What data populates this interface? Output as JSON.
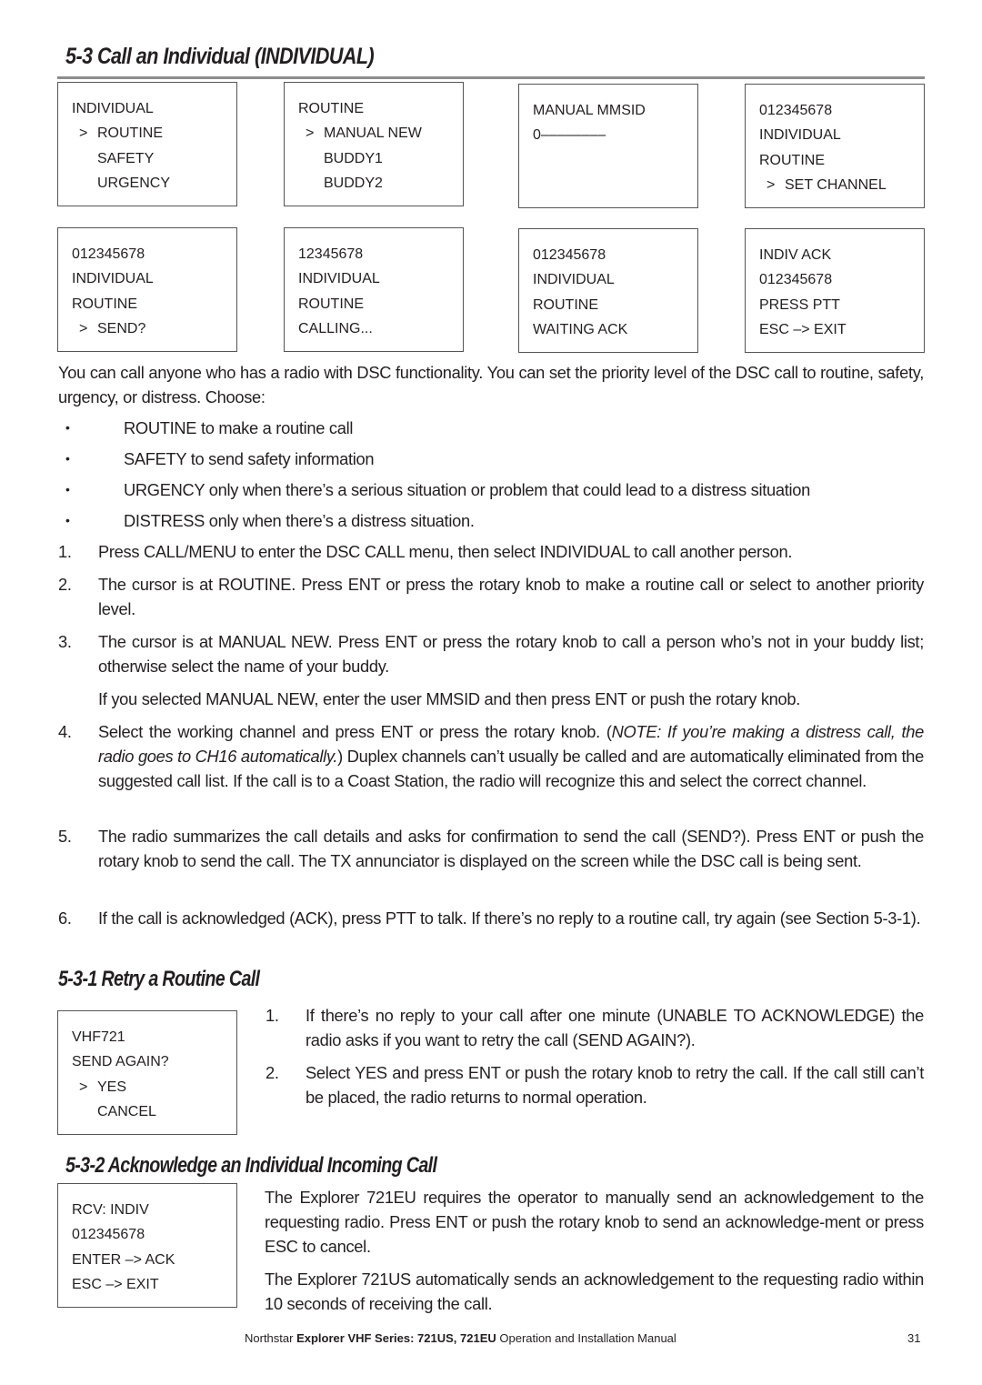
{
  "section": {
    "title": "5-3 Call an Individual (INDIVIDUAL)",
    "screens_row1": [
      {
        "lines": [
          {
            "text": "INDIVIDUAL",
            "style": "plain"
          },
          {
            "text": "ROUTINE",
            "style": "selected"
          },
          {
            "text": "SAFETY",
            "style": "indent"
          },
          {
            "text": "URGENCY",
            "style": "indent"
          }
        ]
      },
      {
        "lines": [
          {
            "text": "ROUTINE",
            "style": "plain"
          },
          {
            "text": "MANUAL NEW",
            "style": "selected"
          },
          {
            "text": "BUDDY1",
            "style": "indent"
          },
          {
            "text": "BUDDY2",
            "style": "indent"
          }
        ]
      },
      {
        "lines": [
          {
            "text": "MANUAL MMSID",
            "style": "plain"
          },
          {
            "text": "0––––––––",
            "style": "plain"
          }
        ]
      },
      {
        "lines": [
          {
            "text": "012345678",
            "style": "plain"
          },
          {
            "text": "INDIVIDUAL",
            "style": "plain"
          },
          {
            "text": "ROUTINE",
            "style": "plain"
          },
          {
            "text": "SET CHANNEL",
            "style": "selected"
          }
        ]
      }
    ],
    "screens_row2": [
      {
        "lines": [
          {
            "text": "012345678",
            "style": "plain"
          },
          {
            "text": "INDIVIDUAL",
            "style": "plain"
          },
          {
            "text": "ROUTINE",
            "style": "plain"
          },
          {
            "text": "SEND?",
            "style": "selected"
          }
        ]
      },
      {
        "lines": [
          {
            "text": "12345678",
            "style": "plain"
          },
          {
            "text": "INDIVIDUAL",
            "style": "plain"
          },
          {
            "text": "ROUTINE",
            "style": "plain"
          },
          {
            "text": "CALLING...",
            "style": "plain"
          }
        ]
      },
      {
        "lines": [
          {
            "text": "012345678",
            "style": "plain"
          },
          {
            "text": "INDIVIDUAL",
            "style": "plain"
          },
          {
            "text": "ROUTINE",
            "style": "plain"
          },
          {
            "text": "WAITING ACK",
            "style": "plain"
          }
        ]
      },
      {
        "lines": [
          {
            "text": "INDIV ACK",
            "style": "plain"
          },
          {
            "text": "012345678",
            "style": "plain"
          },
          {
            "text": "PRESS PTT",
            "style": "plain"
          },
          {
            "text": "ESC –> EXIT",
            "style": "plain"
          }
        ]
      }
    ],
    "intro": "You can call anyone who has a radio with DSC functionality. You can set the priority level of the DSC call to routine, safety, urgency, or distress. Choose:",
    "bullets": [
      "ROUTINE to make a routine call",
      "SAFETY to send safety information",
      "URGENCY only when there’s a serious situation or problem that could lead to a distress situation",
      "DISTRESS only when there’s a distress situation."
    ],
    "steps": [
      {
        "num": "1.",
        "text": "Press CALL/MENU to enter the DSC CALL menu, then select INDIVIDUAL to call another person."
      },
      {
        "num": "2.",
        "text": "The cursor is at ROUTINE. Press ENT or press the rotary knob to make a routine call or select to another priority level."
      },
      {
        "num": "3.",
        "text": "The cursor is at MANUAL NEW.  Press ENT or press the rotary knob to call a person who’s not in your buddy list; otherwise select the name of your buddy."
      },
      {
        "num": "",
        "text": "If you selected MANUAL NEW, enter the user MMSID and then press ENT or push the rotary knob."
      },
      {
        "num": "4.",
        "text_before": "Select the working channel and press ENT or press the rotary knob. (",
        "text_italic": "NOTE: If you’re making a distress call, the radio goes to CH16 automatically.",
        "text_after": ") Duplex channels can’t usually be called and are automatically eliminated from the suggested call list. If the call is to a Coast Station, the radio will recognize this and select the correct channel."
      },
      {
        "num": "5.",
        "text": "The radio summarizes the call details and asks for confirmation to send the call (SEND?). Press ENT or push the rotary knob to send the call. The TX annunciator is displayed on the screen while the DSC call is being sent."
      },
      {
        "num": "6.",
        "text": "If the call is acknowledged (ACK), press PTT to talk. If there’s no reply to a routine call, try again (see Section 5-3-1)."
      }
    ]
  },
  "retry": {
    "title": "5-3-1 Retry a Routine Call",
    "screen": {
      "lines": [
        {
          "text": "VHF721",
          "style": "plain"
        },
        {
          "text": "SEND AGAIN?",
          "style": "plain"
        },
        {
          "text": "YES",
          "style": "selected"
        },
        {
          "text": "CANCEL",
          "style": "indent"
        }
      ]
    },
    "steps": [
      {
        "num": "1.",
        "text": "If there’s no reply to your call after one minute (UNABLE TO ACKNOWLEDGE) the radio asks if you want to retry the call (SEND AGAIN?)."
      },
      {
        "num": "2.",
        "text": "Select YES and press ENT or push the rotary knob to retry the call. If the call still can’t be placed, the radio returns to normal operation."
      }
    ]
  },
  "acknowledge": {
    "title": "5-3-2 Acknowledge an Individual Incoming Call",
    "screen": {
      "lines": [
        {
          "text": "RCV: INDIV",
          "style": "plain"
        },
        {
          "text": "012345678",
          "style": "plain"
        },
        {
          "text": "ENTER –> ACK",
          "style": "plain"
        },
        {
          "text": "ESC –> EXIT",
          "style": "plain"
        }
      ]
    },
    "paragraphs": [
      "The Explorer 721EU requires the operator to manually send an acknowledgement to the requesting radio. Press ENT or push the rotary knob to send an acknowledge-ment or press ESC to cancel.",
      "The Explorer 721US automatically sends an acknowledgement to the requesting radio within 10 seconds of receiving the call."
    ]
  },
  "footer": {
    "brand": "Northstar",
    "product": "Explorer VHF Series: 721US, 721EU",
    "manual": "Operation and Installation Manual",
    "page_number": "31"
  }
}
